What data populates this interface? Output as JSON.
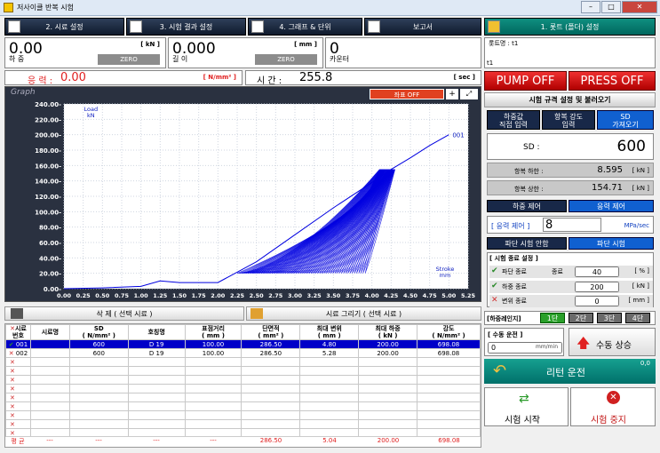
{
  "window": {
    "title": "저사이클 반복 시험",
    "buttons": [
      "–",
      "□",
      "✕"
    ]
  },
  "tabs": [
    {
      "label": "2. 시료 설정",
      "icon": "settings-icon"
    },
    {
      "label": "3. 시험 결과 설정",
      "icon": "edit-icon"
    },
    {
      "label": "4. 그래프 & 단위",
      "icon": "graph-icon"
    },
    {
      "label": "보고서",
      "icon": "printer-icon"
    },
    {
      "label": "1. 롯트 (폴더) 설정",
      "icon": "folder-icon"
    }
  ],
  "load": {
    "value": "0.00",
    "unit": "[ kN ]",
    "label": "하 중",
    "zero": "ZERO"
  },
  "length": {
    "value": "0.000",
    "unit": "[ mm ]",
    "label": "길 이",
    "zero": "ZERO"
  },
  "counter": {
    "value": "0",
    "label": "카운터"
  },
  "stress": {
    "label": "응 력 :",
    "value": "0.00",
    "unit": "[ N/mm² ]"
  },
  "time": {
    "label": "시 간 :",
    "value": "255.8",
    "unit": "[ sec ]"
  },
  "graph": {
    "title": "Graph",
    "coord_label": "좌표 OFF",
    "zoom_in": "+",
    "zoom_fit": "⤢"
  },
  "chart_data": {
    "type": "line",
    "ylabel": "Load\nkN",
    "xlabel": "Stroke\nmm",
    "ylim": [
      0,
      240
    ],
    "xlim": [
      0,
      5.25
    ],
    "y_ticks": [
      "0.00-",
      "20.00-",
      "40.00-",
      "60.00-",
      "80.00-",
      "100.00-",
      "120.00-",
      "140.00-",
      "160.00-",
      "180.00-",
      "200.00-",
      "220.00-",
      "240.00-"
    ],
    "x_ticks": [
      "0.00",
      "0.25",
      "0.50",
      "0.75",
      "1.00",
      "1.25",
      "1.50",
      "1.75",
      "2.00",
      "2.25",
      "2.50",
      "2.75",
      "3.00",
      "3.25",
      "3.50",
      "3.75",
      "4.00",
      "4.25",
      "4.50",
      "4.75",
      "5.00",
      "5.25"
    ],
    "series_label": "001",
    "color": "#0000e0",
    "initial": {
      "x": [
        0,
        0.5,
        1.0,
        1.25,
        1.5,
        2.0,
        2.5,
        3.0,
        3.5,
        4.0,
        4.25,
        4.5,
        4.75,
        5.0
      ],
      "y": [
        0,
        1,
        3,
        10,
        8,
        8,
        35,
        70,
        105,
        138,
        155,
        170,
        186,
        200
      ]
    },
    "cycle_min": 20,
    "cycle_max": 155,
    "unload": {
      "x_start": 2.25,
      "x_end": 4.0
    },
    "reload_end": {
      "x_start": 4.1,
      "x_end": 4.3
    }
  },
  "actions": {
    "delete": "삭 제 ( 선택 시료 )",
    "draw": "시료 그리기 ( 선택 시료 )"
  },
  "table": {
    "headers": [
      "시료\n번호",
      "시료명",
      "SD\n( N/mm² )",
      "호칭명",
      "표점거리\n( mm )",
      "단면적\n( mm² )",
      "최대 변위\n( mm )",
      "최대 하중\n( kN )",
      "강도\n( N/mm² )"
    ],
    "rows": [
      [
        "001",
        "",
        "600",
        "D 19",
        "100.00",
        "286.50",
        "4.80",
        "200.00",
        "698.08"
      ],
      [
        "002",
        "",
        "600",
        "D 19",
        "100.00",
        "286.50",
        "5.28",
        "200.00",
        "698.08"
      ]
    ],
    "empty_rows": 9,
    "avg": [
      "평 균",
      "---",
      "---",
      "---",
      "---",
      "286.50",
      "5.04",
      "200.00",
      "698.08"
    ]
  },
  "right": {
    "lot_label": "롯트명 : t1",
    "lot_value": "t1",
    "pump": "PUMP OFF",
    "press": "PRESS OFF",
    "rule_title": "시험 규격 설정 및 불러오기",
    "btns": [
      "하중값\n직접 입력",
      "항복 강도\n입력",
      "SD\n가져오기"
    ],
    "sd_label": "SD :",
    "sd_value": "600",
    "yield_low_label": "항복 하한 :",
    "yield_low_value": "8.595",
    "yield_low_unit": "[ kN ]",
    "yield_high_label": "항복 상한 :",
    "yield_high_value": "154.71",
    "yield_high_unit": "[ kN ]",
    "load_ctrl": "하중 제어",
    "stress_ctrl": "응력 제어",
    "stress_ctrl_label": "[ 응력 제어 ]",
    "stress_ctrl_value": "8",
    "stress_ctrl_unit": "MPa/sec",
    "fracture_off": "파단 시험 안함",
    "fracture_on": "파단 시험",
    "end_title": "[ 시험 종료 설정 ]",
    "end_rows": [
      {
        "label": "파단 종료",
        "sub": "종료",
        "value": "40",
        "unit": "[ % ]",
        "checked": true
      },
      {
        "label": "하중 종료",
        "sub": "",
        "value": "200",
        "unit": "[ kN ]",
        "checked": true
      },
      {
        "label": "변위 종료",
        "sub": "",
        "value": "0",
        "unit": "[ mm ]",
        "checked": false
      }
    ],
    "range_label": "[하중레인지]",
    "ranges": [
      "1단",
      "2단",
      "3단",
      "4단"
    ],
    "manual_label": "[ 수동 운전 ]",
    "manual_value": "0",
    "manual_unit": "mm/min",
    "up": "수동 상승",
    "return_label": "리턴 운전",
    "return_value": "0,0",
    "start": "시험 시작",
    "stop": "시험 중지"
  }
}
